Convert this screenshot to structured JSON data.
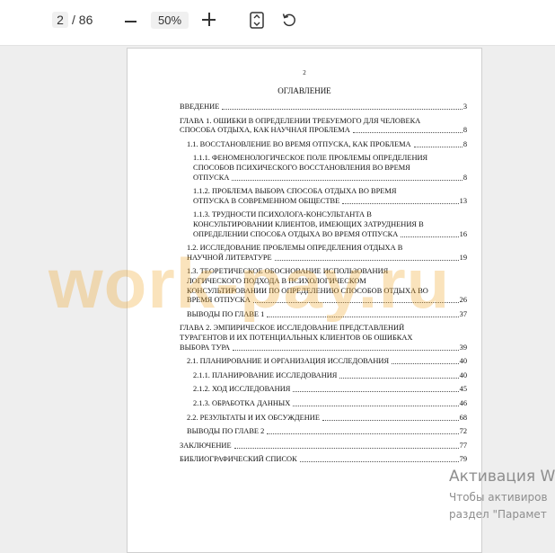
{
  "toolbar": {
    "current_page": "2",
    "total_pages": "/ 86",
    "zoom": "50%",
    "icons": [
      "zoom-out-icon",
      "zoom-in-icon",
      "fit-page-icon",
      "rotate-icon"
    ]
  },
  "document": {
    "page_number": "2",
    "title": "ОГЛАВЛЕНИЕ",
    "toc": [
      {
        "level": 1,
        "lines": [
          "ВВЕДЕНИЕ"
        ],
        "page": "3"
      },
      {
        "level": 1,
        "lines": [
          "ГЛАВА 1. ОШИБКИ В ОПРЕДЕЛЕНИИ ТРЕБУЕМОГО ДЛЯ ЧЕЛОВЕКА",
          "СПОСОБА ОТДЫХА, КАК НАУЧНАЯ ПРОБЛЕМА"
        ],
        "page": "8"
      },
      {
        "level": 2,
        "lines": [
          "1.1.   ВОССТАНОВЛЕНИЕ ВО ВРЕМЯ ОТПУСКА, КАК ПРОБЛЕМА"
        ],
        "page": "8"
      },
      {
        "level": 3,
        "lines": [
          "1.1.1.   ФЕНОМЕНОЛОГИЧЕСКОЕ ПОЛЕ ПРОБЛЕМЫ ОПРЕДЕЛЕНИЯ",
          "СПОСОБОВ ПСИХИЧЕСКОГО ВОССТАНОВЛЕНИЯ ВО ВРЕМЯ",
          "ОТПУСКА"
        ],
        "page": "8"
      },
      {
        "level": 3,
        "lines": [
          "1.1.2.   ПРОБЛЕМА ВЫБОРА СПОСОБА ОТДЫХА ВО ВРЕМЯ",
          "ОТПУСКА В СОВРЕМЕННОМ ОБЩЕСТВЕ"
        ],
        "page": "13"
      },
      {
        "level": 3,
        "lines": [
          "1.1.3.   ТРУДНОСТИ ПСИХОЛОГА-КОНСУЛЬТАНТА В",
          "КОНСУЛЬТИРОВАНИИ КЛИЕНТОВ, ИМЕЮЩИХ ЗАТРУДНЕНИЯ В",
          "ОПРЕДЕЛЕНИИ СПОСОБА ОТДЫХА ВО ВРЕМЯ ОТПУСКА"
        ],
        "page": "16"
      },
      {
        "level": 2,
        "lines": [
          "1.2.   ИССЛЕДОВАНИЕ ПРОБЛЕМЫ ОПРЕДЕЛЕНИЯ ОТДЫХА В",
          "НАУЧНОЙ ЛИТЕРАТУРЕ"
        ],
        "page": "19"
      },
      {
        "level": 2,
        "lines": [
          "1.3.   ТЕОРЕТИЧЕСКОЕ ОБОСНОВАНИЕ ИСПОЛЬЗОВАНИЯ",
          "ЛОГИЧЕСКОГО ПОДХОДА В ПСИХОЛОГИЧЕСКОМ",
          "КОНСУЛЬТИРОВАНИИ ПО ОПРЕДЕЛЕНИЮ СПОСОБОВ ОТДЫХА ВО",
          "ВРЕМЯ ОТПУСКА"
        ],
        "page": "26"
      },
      {
        "level": 2,
        "lines": [
          "ВЫВОДЫ ПО ГЛАВЕ 1"
        ],
        "page": "37"
      },
      {
        "level": 1,
        "lines": [
          "ГЛАВА 2. ЭМПИРИЧЕСКОЕ ИССЛЕДОВАНИЕ ПРЕДСТАВЛЕНИЙ",
          "ТУРАГЕНТОВ И ИХ ПОТЕНЦИАЛЬНЫХ КЛИЕНТОВ ОБ ОШИБКАХ",
          "ВЫБОРА ТУРА"
        ],
        "page": "39"
      },
      {
        "level": 2,
        "lines": [
          "2.1. ПЛАНИРОВАНИЕ И ОРГАНИЗАЦИЯ ИССЛЕДОВАНИЯ"
        ],
        "page": "40"
      },
      {
        "level": 3,
        "lines": [
          "2.1.1. ПЛАНИРОВАНИЕ ИССЛЕДОВАНИЯ"
        ],
        "page": "40"
      },
      {
        "level": 3,
        "lines": [
          "2.1.2. ХОД ИССЛЕДОВАНИЯ"
        ],
        "page": "45"
      },
      {
        "level": 3,
        "lines": [
          "2.1.3. ОБРАБОТКА ДАННЫХ"
        ],
        "page": "46"
      },
      {
        "level": 2,
        "lines": [
          "2.2. РЕЗУЛЬТАТЫ И ИХ ОБСУЖДЕНИЕ"
        ],
        "page": "68"
      },
      {
        "level": 2,
        "lines": [
          "ВЫВОДЫ ПО ГЛАВЕ 2"
        ],
        "page": "72"
      },
      {
        "level": 1,
        "lines": [
          "ЗАКЛЮЧЕНИЕ"
        ],
        "page": "77"
      },
      {
        "level": 1,
        "lines": [
          "БИБЛИОГРАФИЧЕСКИЙ СПИСОК"
        ],
        "page": "79"
      }
    ]
  },
  "watermark": "work-pay.ru",
  "activation": {
    "line1": "Активация W",
    "line2": "Чтобы активиров",
    "line3": "раздел \"Парамет"
  },
  "colors": {
    "watermark": "#eea730",
    "background": "#eeeeee",
    "toolbar": "#ffffff"
  }
}
